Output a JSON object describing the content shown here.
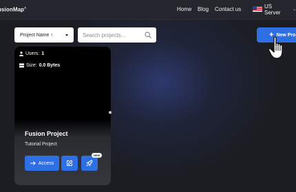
{
  "header": {
    "logo": "usionMap",
    "logo_sup": "®",
    "nav": [
      "Home",
      "Blog",
      "Contact us"
    ],
    "server": {
      "label": "US Server",
      "flag_icon": "us-flag-icon"
    }
  },
  "toolbar": {
    "sort": {
      "selected": "Project Name ↑"
    },
    "search": {
      "placeholder": "Search projects...",
      "value": ""
    },
    "new_button": {
      "label": "New Pro"
    }
  },
  "project_card": {
    "users_label": "Users:",
    "users_value": "1",
    "size_label": "Size:",
    "size_value": "0.0 Bytes",
    "title": "Fusion Project",
    "subtitle": "Tutorial Project",
    "access_label": "Access",
    "badge": "NEW"
  },
  "colors": {
    "accent": "#2f6fe4",
    "background": "#1b1d22",
    "topbar": "#23262c",
    "card": "#303338"
  }
}
